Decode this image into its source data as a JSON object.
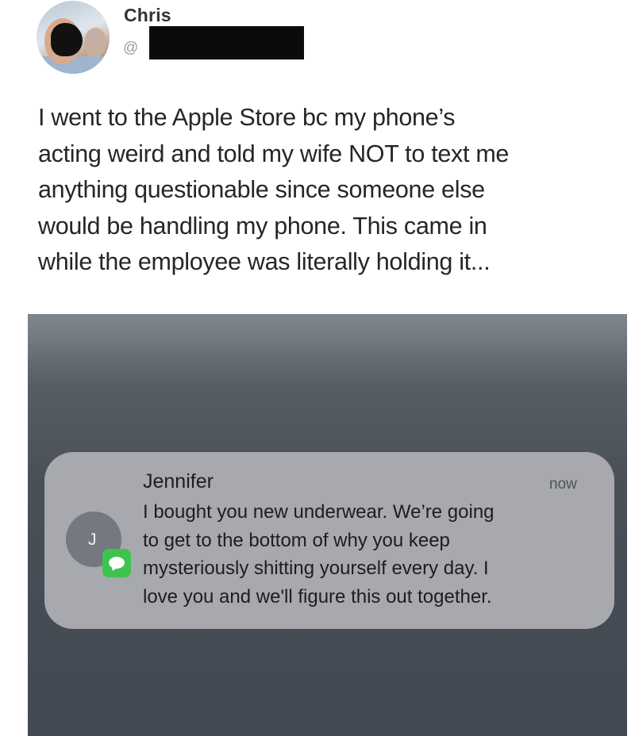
{
  "tweet": {
    "user_name": "Chris",
    "handle_prefix": "@",
    "text_lines": [
      "I went to the Apple Store bc my phone’s",
      "acting weird and told my wife NOT to text me",
      "anything questionable since someone else",
      "would be handling my phone. This came in",
      "while the employee was literally holding it..."
    ]
  },
  "notification": {
    "avatar_initial": "J",
    "app_icon": "messages-icon",
    "sender": "Jennifer",
    "time": "now",
    "body_lines": [
      "I bought you new underwear. We’re going",
      "to get to the bottom of why you keep",
      "mysteriously shitting yourself every day. I",
      "love you and we'll figure this out together."
    ]
  },
  "colors": {
    "text_primary": "#262626",
    "lockscreen_bg": "#4a5058",
    "notification_bg": "#a7a9ae",
    "messages_green": "#3ec34f"
  }
}
